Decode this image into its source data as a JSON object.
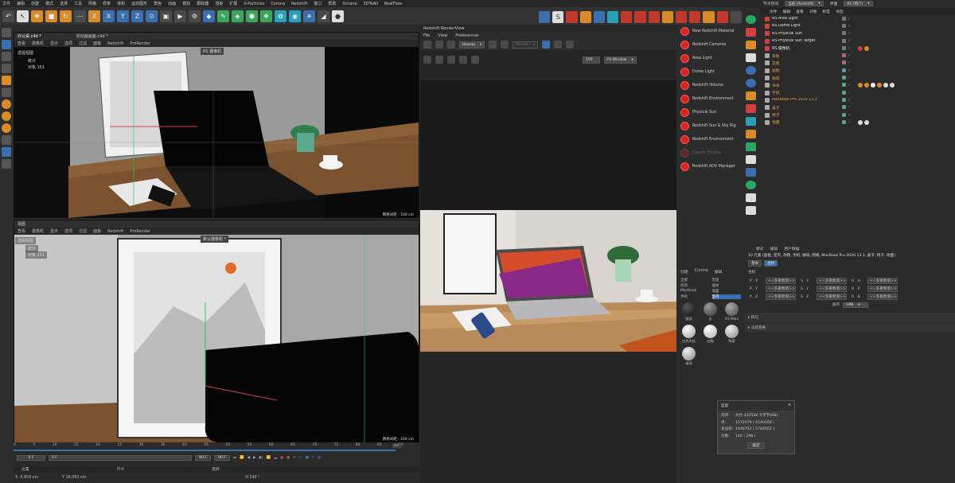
{
  "menubar": [
    "文件",
    "编辑",
    "创建",
    "模式",
    "选择",
    "工具",
    "网格",
    "样条",
    "体积",
    "运动图形",
    "角色",
    "动画",
    "模拟",
    "跟踪器",
    "渲染",
    "扩展",
    "X-Particles",
    "Corona",
    "Redshift",
    "窗口",
    "帮助",
    "Octane",
    "3DToAll",
    "RealFlow"
  ],
  "top_right_tabs": {
    "layout_label": "节点空间",
    "layout_value": "当前 (Redshift)",
    "interface_label": "界面",
    "interface_value": "RS (用户)"
  },
  "viewport1": {
    "tabs": [
      "办公桌.c4d *",
      "欢动画画面.c4d *"
    ],
    "menu": [
      "查看",
      "摄像机",
      "显示",
      "选项",
      "过滤",
      "面板",
      "Redshift",
      "ProRender"
    ],
    "label": "透视视图",
    "hud_lines": [
      "统计",
      "对象 151"
    ],
    "cam_label": "RS 摄像机",
    "grid_text": "网格间距 : 100 cm"
  },
  "viewport2": {
    "title": "视图",
    "menu": [
      "查看",
      "摄像机",
      "显示",
      "选项",
      "过滤",
      "面板",
      "Redshift",
      "ProRender"
    ],
    "label": "透视视图",
    "hud_lines": [
      "统计",
      "对象 151"
    ],
    "cam_label": "默认摄像机 *",
    "grid_text": "网格间距 : 100 cm"
  },
  "renderview": {
    "title": "Redshift RenderView",
    "menu": [
      "File",
      "View",
      "Preferences"
    ],
    "beauty": "Beauty",
    "render_sel": "Render",
    "zoom": "100",
    "fit": "Fit Window"
  },
  "redshift_menu": [
    "New Redshift Material",
    "Redshift Cameras",
    "Area Light",
    "Dome Light",
    "Redshift Volume",
    "Redshift Environment",
    "Physical Sun",
    "Redshift Sun & Sky Rig",
    "Redshift Environment",
    "Caustic Emitter",
    "Redshift AOV Manager"
  ],
  "objmgr": {
    "menu": [
      "文件",
      "编辑",
      "查看",
      "对象",
      "标签",
      "书签"
    ],
    "rows": [
      {
        "name": "RS Area Light",
        "color": "#e6e6e6",
        "sq": "#777"
      },
      {
        "name": "RS Dome Light",
        "color": "#e6e6e6",
        "sq": "#777"
      },
      {
        "name": "RS Physical Sun",
        "color": "#e6e6e6",
        "sq": "#777"
      },
      {
        "name": "RS Physical Sun Target",
        "color": "#e6e6e6",
        "sq": "#777"
      },
      {
        "name": "RS 摄像机",
        "color": "#e6e6e6",
        "sq": "#777"
      },
      {
        "name": "背板",
        "color": "#e89b3d",
        "sq": "#e34b8b"
      },
      {
        "name": "花瓶",
        "color": "#e89b3d",
        "sq": "#e34b8b"
      },
      {
        "name": "画框",
        "color": "#e89b3d",
        "sq": "#32c2d8"
      },
      {
        "name": "咖啡",
        "color": "#e89b3d",
        "sq": "#2fd37a"
      },
      {
        "name": "书本",
        "color": "#e89b3d",
        "sq": "#2fd37a"
      },
      {
        "name": "手机",
        "color": "#e89b3d",
        "sq": "#2fd37a"
      },
      {
        "name": "MacBook Pro 2020 13.3",
        "color": "#e89b3d",
        "sq": "#2fd37a"
      },
      {
        "name": "桌子",
        "color": "#e89b3d",
        "sq": "#2fd37a"
      },
      {
        "name": "椅子",
        "color": "#e89b3d",
        "sq": "#2fd37a"
      },
      {
        "name": "地面",
        "color": "#e89b3d",
        "sq": "#2fd37a"
      }
    ]
  },
  "attr": {
    "menu": [
      "模式",
      "编辑",
      "用户数据"
    ],
    "summary": "10 元素 [画框, 室内, 杂物, 手机, 咖啡, 网格, MacBook Pro 2020 13.3, 桌子, 椅子, 地面]",
    "tabs": [
      "基本",
      "坐标"
    ],
    "section": "坐标",
    "rows": [
      {
        "a": "P . X",
        "av": "<<多重数值>>",
        "b": "S . X",
        "bv": "<<多重数值>>",
        "c": "R . H",
        "cv": "<<多重数值>>"
      },
      {
        "a": "P . Y",
        "av": "<<多重数值>>",
        "b": "S . Y",
        "bv": "<<多重数值>>",
        "c": "R . P",
        "cv": "<<多重数值>>"
      },
      {
        "a": "P . Z",
        "av": "<<多重数值>>",
        "b": "S . Z",
        "bv": "<<多重数值>>",
        "c": "R . B",
        "cv": "<<多重数值>>"
      }
    ],
    "order_label": "顺序",
    "order_value": "HPB",
    "fold1": "▸ 四元",
    "fold2": "▸ 冻结变换"
  },
  "matpanel": {
    "menu": [
      "创建",
      "Corona",
      "编辑"
    ],
    "filters": [
      "全部",
      "无层",
      "内饰",
      "墙体",
      "MacBook",
      "墙面",
      "手机",
      "室内"
    ],
    "mats": [
      {
        "name": "镜面",
        "c1": "#111",
        "c2": "#555"
      },
      {
        "name": "金",
        "c1": "#333",
        "c2": "#999"
      },
      {
        "name": "RS Mats",
        "c1": "#444",
        "c2": "#aaa"
      },
      {
        "name": "白色木纹",
        "c1": "#999",
        "c2": "#fff"
      },
      {
        "name": "白釉",
        "c1": "#aaa",
        "c2": "#fff"
      },
      {
        "name": "陶瓷",
        "c1": "#888",
        "c2": "#eee"
      },
      {
        "name": "玻璃",
        "c1": "#888",
        "c2": "#eee"
      }
    ]
  },
  "info": {
    "title": "信息",
    "rows": [
      [
        "内存:",
        "大约 432538 千字节(KB)"
      ],
      [
        "点:",
        "1572479 ( 6140358 )"
      ],
      [
        "多边形:",
        "1448752 ( 5744502 )"
      ],
      [
        "对象:",
        "146 ( 298 )"
      ]
    ],
    "ok": "确定"
  },
  "timeline": {
    "ticks": [
      "0",
      "5",
      "10",
      "15",
      "20",
      "25",
      "30",
      "35",
      "40",
      "45",
      "50",
      "55",
      "60",
      "65",
      "70",
      "75",
      "80",
      "85",
      "90"
    ],
    "start": "0 F",
    "cur": "0 F",
    "end1": "90 F",
    "end2": "90 F",
    "frame_box": "0 F",
    "pos_label": "位置",
    "size_label": "尺寸",
    "rot_label": "旋转",
    "x": "-5.859 cm",
    "y": "16.093 cm",
    "h": "540 °"
  }
}
